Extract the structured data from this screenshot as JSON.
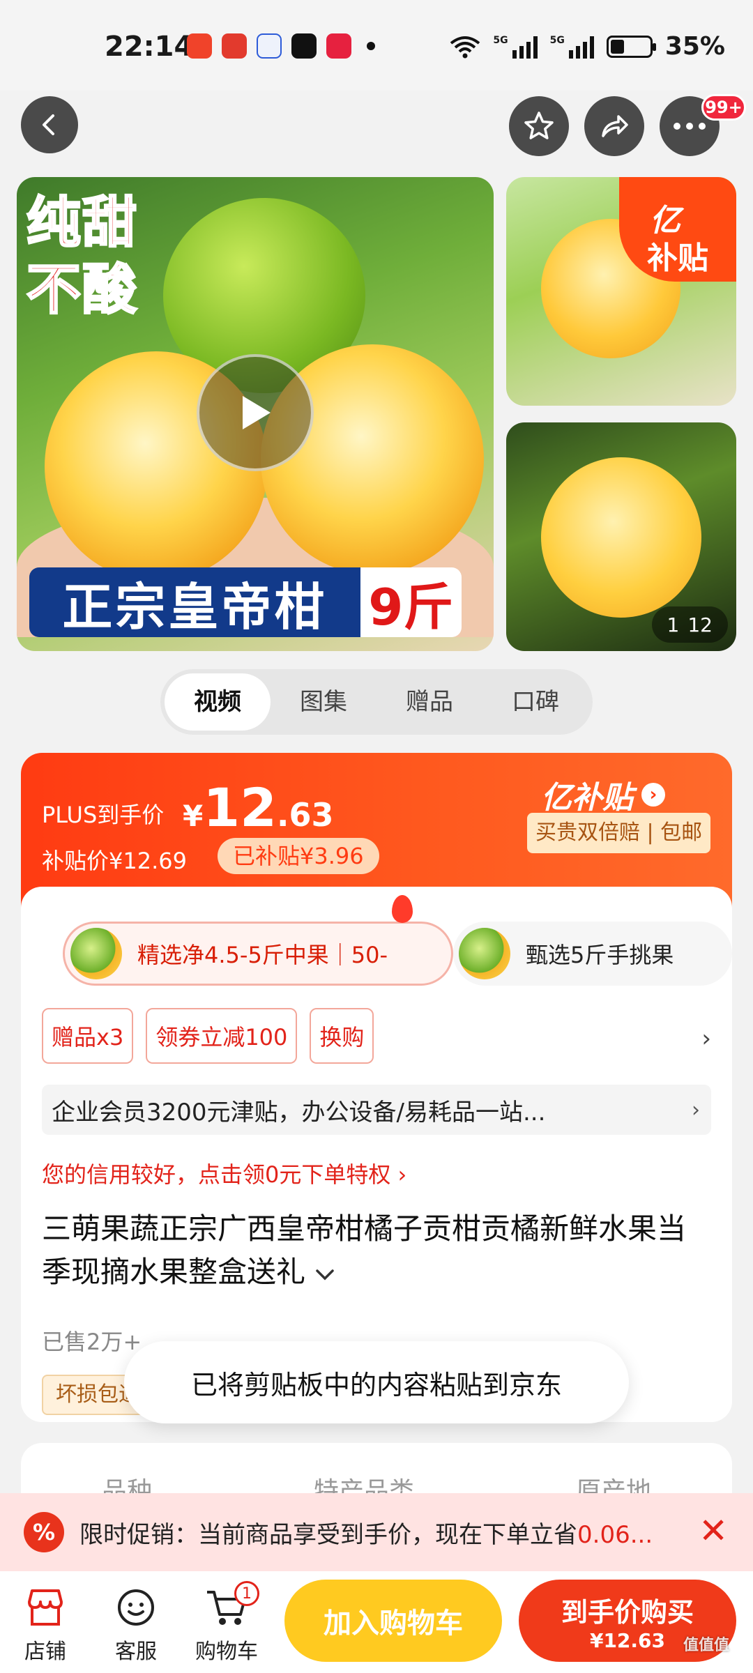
{
  "status_bar": {
    "time": "22:14",
    "signal1": "5G",
    "signal2": "5G",
    "battery_pct": "35%",
    "battery_level": 0.35
  },
  "nav": {
    "more_badge": "99+"
  },
  "gallery": {
    "main_tag_line1": "纯甜",
    "main_tag_line2": "不酸",
    "banner_text": "正宗皇帝柑",
    "banner_weight": "9斤",
    "badge_line1": "亿",
    "badge_line2": "补贴",
    "counter_current": "1",
    "counter_total": "12"
  },
  "tabs": [
    {
      "label": "视频",
      "active": true
    },
    {
      "label": "图集",
      "active": false
    },
    {
      "label": "赠品",
      "active": false
    },
    {
      "label": "口碑",
      "active": false
    }
  ],
  "price": {
    "plus_label": "PLUS到手价",
    "currency": "¥",
    "plus_int": "12",
    "plus_dec": ".63",
    "subsidy_label": "补贴价¥12.69",
    "subsidy_tag": "已补贴¥3.96",
    "logo_text": "亿补贴",
    "logo_arrow": "›",
    "guarantee": "买贵双倍赔 | 包邮"
  },
  "specs": [
    {
      "text": "精选净4.5-5斤中果｜50-"
    },
    {
      "text": "甄选5斤手挑果"
    }
  ],
  "chips": [
    "赠品x3",
    "领券立减100",
    "换购"
  ],
  "chips_arrow": "›",
  "corp_banner": "企业会员3200元津贴，办公设备/易耗品一站...",
  "corp_arrow": "›",
  "credit": "您的信用较好，点击领0元下单特权 ›",
  "product_title": "三萌果蔬正宗广西皇帝柑橘子贡柑贡橘新鲜水果当季现摘水果整盒送礼",
  "sold": "已售2万+",
  "damage_tag": "坏损包退",
  "toast": "已将剪贴板中的内容粘贴到京东",
  "attrs": [
    "品种",
    "特产品类",
    "原产地"
  ],
  "promo": {
    "icon": "%",
    "text": "限时促销：当前商品享受到手价，现在下单立省",
    "amount": "0.06...",
    "close": "✕"
  },
  "bottom_nav": [
    {
      "label": "店铺"
    },
    {
      "label": "客服"
    },
    {
      "label": "购物车",
      "badge": "1"
    }
  ],
  "btn_cart": "加入购物车",
  "btn_buy": {
    "line1": "到手价购买",
    "line2": "¥12.63"
  },
  "watermark": "值值值"
}
